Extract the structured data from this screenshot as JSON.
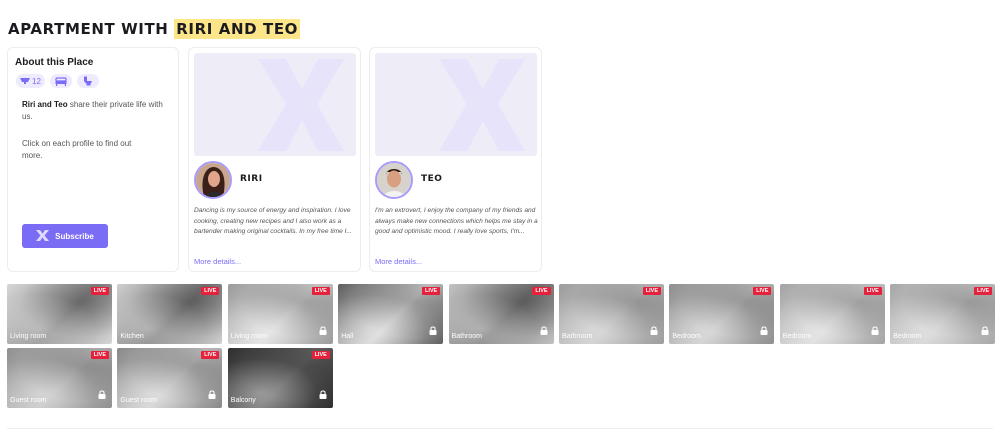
{
  "page": {
    "title_prefix": "APARTMENT WITH ",
    "title_highlight": "RIRI AND TEO"
  },
  "about": {
    "heading": "About this Place",
    "camera_count": "12",
    "pill_icons": [
      "camera-icon",
      "bed-icon",
      "toilet-icon"
    ],
    "desc_bold": "Riri and Teo",
    "desc_rest": " share their private life with us.",
    "hint": "Click on each profile to find out more.",
    "subscribe_label": "Subscribe"
  },
  "profiles": [
    {
      "name": "RIRI",
      "bio": "Dancing is my source of energy and inspiration. I love cooking, creating new recipes and I also work as a bartender making original cocktails. In my free time I...",
      "more": "More details..."
    },
    {
      "name": "TEO",
      "bio": "I'm an extrovert, I enjoy the company of my friends and always make new connections which helps me stay in a good and optimistic mood. I really love sports, I'm...",
      "more": "More details..."
    }
  ],
  "cameras": [
    {
      "label": "Living room",
      "live": "LIVE",
      "locked": false
    },
    {
      "label": "Kitchen",
      "live": "LIVE",
      "locked": false
    },
    {
      "label": "Living room",
      "live": "LIVE",
      "locked": true
    },
    {
      "label": "Hall",
      "live": "LIVE",
      "locked": true
    },
    {
      "label": "Bathroom",
      "live": "LIVE",
      "locked": true
    },
    {
      "label": "Bathroom",
      "live": "LIVE",
      "locked": true
    },
    {
      "label": "Bedroom",
      "live": "LIVE",
      "locked": true
    },
    {
      "label": "Bedroom",
      "live": "LIVE",
      "locked": true
    },
    {
      "label": "Bedroom",
      "live": "LIVE",
      "locked": true
    },
    {
      "label": "Guest room",
      "live": "LIVE",
      "locked": true
    },
    {
      "label": "Guest room",
      "live": "LIVE",
      "locked": true
    },
    {
      "label": "Balcony",
      "live": "LIVE",
      "locked": true
    }
  ],
  "colors": {
    "accent": "#7b6cf6",
    "live_badge": "#e5213c",
    "highlight": "#fde68a"
  }
}
